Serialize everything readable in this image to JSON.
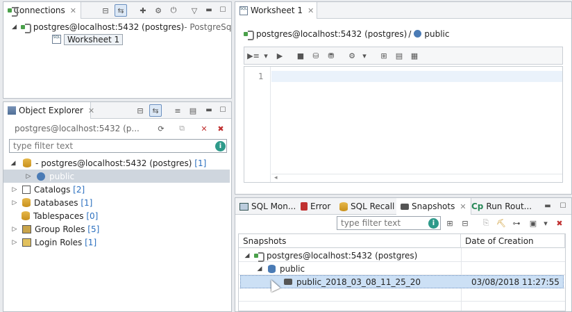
{
  "connections": {
    "tab_label": "Connections",
    "server": "postgres@localhost:5432 (postgres)",
    "server_suffix": " - PostgreSql",
    "worksheet": "Worksheet 1"
  },
  "object_explorer": {
    "tab_label": "Object Explorer",
    "connection_label": "postgres@localhost:5432 (p...",
    "filter_placeholder": "type filter text",
    "root": "- postgres@localhost:5432 (postgres)",
    "root_count": "[1]",
    "selected": "public",
    "items": [
      {
        "label": "Catalogs",
        "count": "[2]"
      },
      {
        "label": "Databases",
        "count": "[1]"
      },
      {
        "label": "Tablespaces",
        "count": "[0]"
      },
      {
        "label": "Group Roles",
        "count": "[5]"
      },
      {
        "label": "Login Roles",
        "count": "[1]"
      }
    ]
  },
  "worksheet": {
    "tab_label": "Worksheet 1",
    "breadcrumb_server": "postgres@localhost:5432 (postgres)",
    "breadcrumb_sep": "/",
    "breadcrumb_schema": "public",
    "line_number": "1"
  },
  "bottom_panel": {
    "tabs": [
      "SQL Mon...",
      "Error",
      "SQL Recall",
      "Snapshots",
      "Run Rout..."
    ],
    "filter_placeholder": "type filter text",
    "columns": [
      "Snapshots",
      "Date of Creation"
    ],
    "tree": {
      "server": "postgres@localhost:5432 (postgres)",
      "schema": "public",
      "snapshot": "public_2018_03_08_11_25_20",
      "snapshot_date": "03/08/2018 11:27:55"
    }
  },
  "colors": {
    "selection": "#cce0f5",
    "accent": "#2a6fbf",
    "info": "#2e9a8a"
  }
}
